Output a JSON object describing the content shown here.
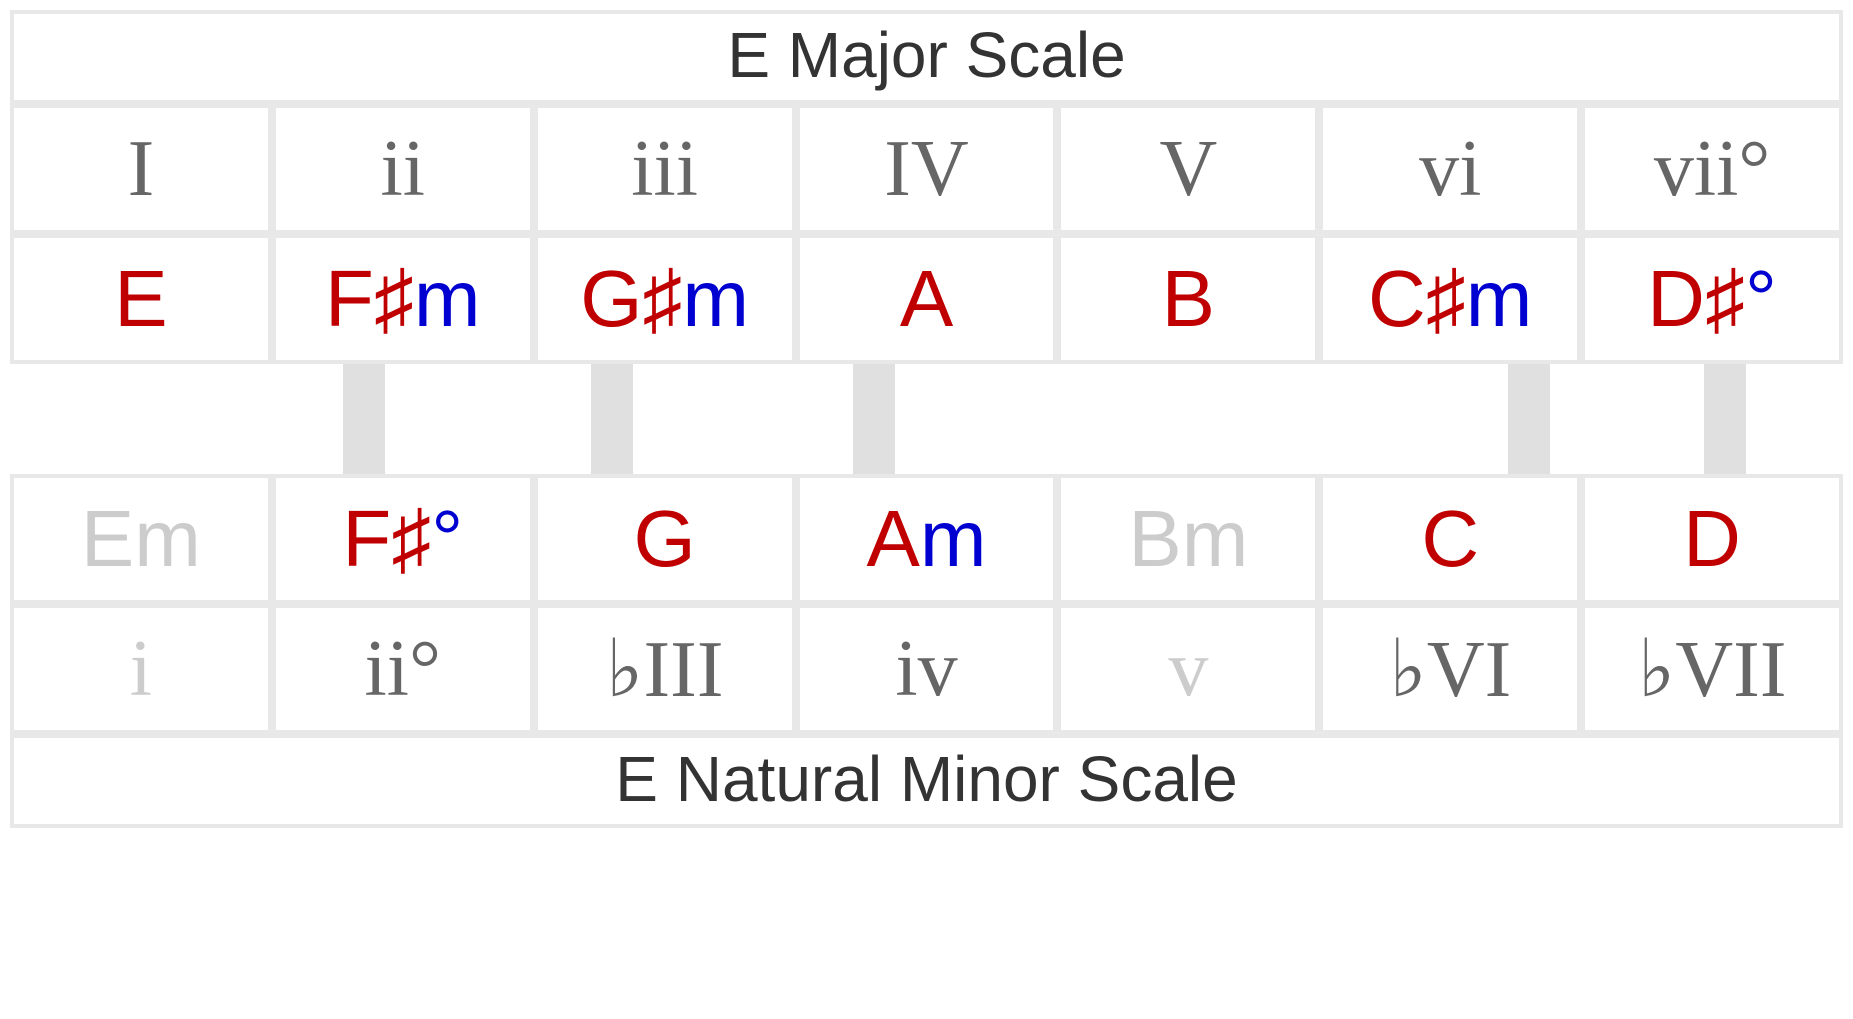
{
  "major": {
    "title": "E Major Scale",
    "roman": [
      "I",
      "ii",
      "iii",
      "IV",
      "V",
      "vi",
      "vii°"
    ],
    "chords": [
      {
        "root": "E",
        "quality": ""
      },
      {
        "root": "F♯",
        "quality": "m"
      },
      {
        "root": "G♯",
        "quality": "m"
      },
      {
        "root": "A",
        "quality": ""
      },
      {
        "root": "B",
        "quality": ""
      },
      {
        "root": "C♯",
        "quality": "m"
      },
      {
        "root": "D♯",
        "quality": "°"
      }
    ]
  },
  "minor": {
    "title": "E Natural Minor Scale",
    "roman": [
      "i",
      "ii°",
      "♭III",
      "iv",
      "v",
      "♭VI",
      "♭VII"
    ],
    "roman_dimmed": [
      true,
      false,
      false,
      false,
      true,
      false,
      false
    ],
    "chords": [
      {
        "root": "E",
        "quality": "m",
        "dimmed": true
      },
      {
        "root": "F♯",
        "quality": "°",
        "dimmed": false
      },
      {
        "root": "G",
        "quality": "",
        "dimmed": false
      },
      {
        "root": "A",
        "quality": "m",
        "dimmed": false
      },
      {
        "root": "B",
        "quality": "m",
        "dimmed": true
      },
      {
        "root": "C",
        "quality": "",
        "dimmed": false
      },
      {
        "root": "D",
        "quality": "",
        "dimmed": false
      }
    ]
  },
  "connectors": [
    {
      "col": 1,
      "offset": 0.35
    },
    {
      "col": 2,
      "offset": 0.3
    },
    {
      "col": 3,
      "offset": 0.3
    },
    {
      "col": 5,
      "offset": 0.8
    },
    {
      "col": 6,
      "offset": 0.55
    }
  ]
}
